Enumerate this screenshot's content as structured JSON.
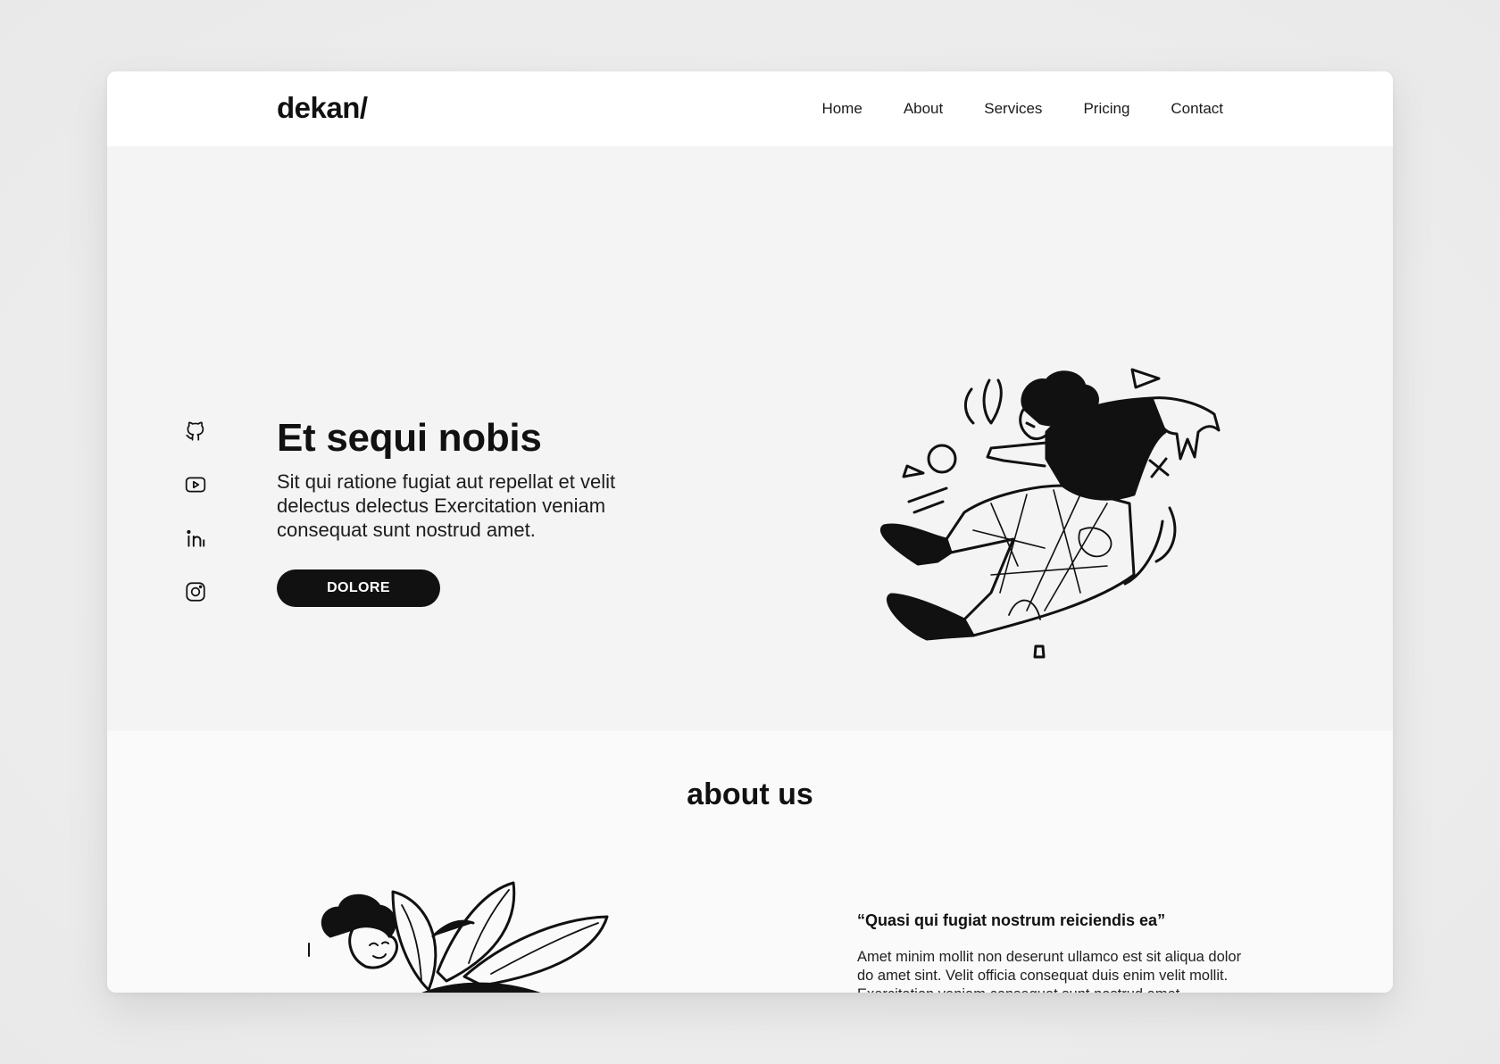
{
  "brand": {
    "logo": "dekan/"
  },
  "nav": {
    "items": [
      {
        "label": "Home"
      },
      {
        "label": "About"
      },
      {
        "label": "Services"
      },
      {
        "label": "Pricing"
      },
      {
        "label": "Contact"
      }
    ]
  },
  "social": {
    "icons": [
      "github-icon",
      "youtube-icon",
      "linkedin-icon",
      "instagram-icon"
    ]
  },
  "hero": {
    "title": "Et sequi nobis",
    "text": "Sit qui ratione fugiat aut repellat et velit delectus delectus Exercitation veniam consequat sunt nostrud amet.",
    "button": "DOLORE",
    "illustration": "falling-person-illustration"
  },
  "about": {
    "title": "about us",
    "quote": "“Quasi qui fugiat nostrum reiciendis ea”",
    "text": "Amet minim mollit non deserunt ullamco est sit aliqua dolor do amet sint.  Velit officia consequat duis enim velit mollit. Exercitation veniam consequat sunt nostrud amet.",
    "illustration": "person-with-plant-illustration"
  },
  "colors": {
    "primary": "#111111",
    "header_bg": "#ffffff",
    "hero_bg": "#f4f4f4",
    "about_bg": "#fafafa"
  }
}
